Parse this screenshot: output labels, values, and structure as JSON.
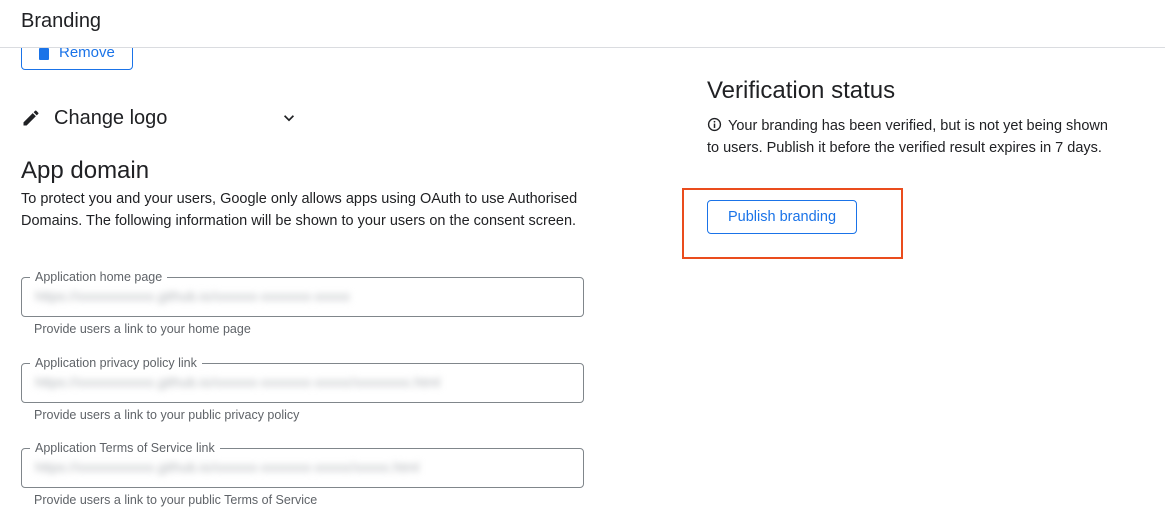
{
  "header": {
    "title": "Branding"
  },
  "logo": {
    "remove_label": "Remove",
    "change_logo_label": "Change logo"
  },
  "app_domain": {
    "heading": "App domain",
    "description": "To protect you and your users, Google only allows apps using OAuth to use Authorised Domains. The following information will be shown to your users on the consent screen.",
    "fields": [
      {
        "label": "Application home page",
        "value": "https://xxxxxxxxxxx.github.io/xxxxxx-xxxxxxx-xxxxx",
        "hint": "Provide users a link to your home page"
      },
      {
        "label": "Application privacy policy link",
        "value": "https://xxxxxxxxxxx.github.io/xxxxxx-xxxxxxx-xxxxx/xxxxxxxx.html",
        "hint": "Provide users a link to your public privacy policy"
      },
      {
        "label": "Application Terms of Service link",
        "value": "https://xxxxxxxxxxx.github.io/xxxxxx-xxxxxxx-xxxxx/xxxxx.html",
        "hint": "Provide users a link to your public Terms of Service"
      }
    ]
  },
  "verification": {
    "heading": "Verification status",
    "message": "Your branding has been verified, but is not yet being shown to users. Publish it before the verified result expires in 7 days.",
    "publish_label": "Publish branding"
  },
  "colors": {
    "accent": "#1a73e8",
    "highlight": "#ea4c1d",
    "text": "#202124",
    "secondary_text": "#5f6368",
    "border": "#80868b"
  },
  "icons": {
    "remove": "trash-icon",
    "change_logo": "pencil-icon",
    "expand": "chevron-down-icon",
    "info": "info-icon"
  }
}
